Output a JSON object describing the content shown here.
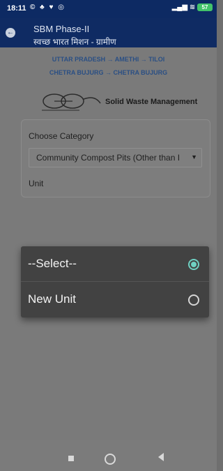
{
  "status_bar": {
    "time": "18:11",
    "left_icons": "© ♣ ♥ ◎",
    "battery": "57"
  },
  "app_bar": {
    "title": "SBM Phase-II",
    "subtitle": "स्वच्छ भारत मिशन - ग्रामीण"
  },
  "location": {
    "path1": "UTTAR PRADESH → AMETHI → TILOI",
    "path2": "CHETRA BUJURG → CHETRA BUJURG"
  },
  "brand": {
    "text": "Solid Waste Management"
  },
  "form": {
    "category_label": "Choose Category",
    "category_value": "Community Compost Pits (Other than I",
    "unit_label": "Unit"
  },
  "dialog": {
    "options": [
      {
        "label": "--Select--",
        "selected": true
      },
      {
        "label": "New Unit",
        "selected": false
      }
    ],
    "accent": "#6fd0c2"
  }
}
